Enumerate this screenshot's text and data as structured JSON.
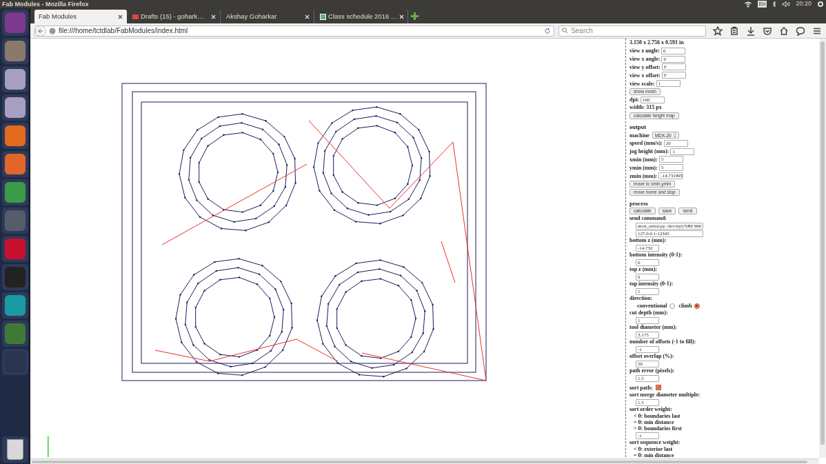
{
  "window": {
    "title": "Fab Modules - Mozilla Firefox"
  },
  "indicators": {
    "keyboard": "En",
    "time": "20:20"
  },
  "tabs": [
    {
      "title": "Fab Modules",
      "selected": true,
      "kind": "plain"
    },
    {
      "title": "Drafts (15) - gohark…",
      "selected": false,
      "kind": "mail"
    },
    {
      "title": "Akshay Goharkar",
      "selected": false,
      "kind": "plain"
    },
    {
      "title": "Class schedule 2016 …",
      "selected": false,
      "kind": "site"
    }
  ],
  "address_bar": {
    "url": "file:///home/tctdlab/FabModules/index.html"
  },
  "search": {
    "placeholder": "Search"
  },
  "panel": [
    {
      "kind": "text",
      "text": "3.150 x 2.756 x 0.591 in"
    },
    {
      "kind": "field",
      "label": "view z angle:",
      "value": "0"
    },
    {
      "kind": "field",
      "label": "view x angle:",
      "value": "0"
    },
    {
      "kind": "field",
      "label": "view y offset:",
      "value": "0"
    },
    {
      "kind": "field",
      "label": "view x offset:",
      "value": "0"
    },
    {
      "kind": "field",
      "label": "view scale:",
      "value": "1"
    },
    {
      "kind": "buttons",
      "buttons": [
        "show mesh"
      ]
    },
    {
      "kind": "field",
      "label": "dpi:",
      "value": "100"
    },
    {
      "kind": "text",
      "text": "width: 315 px"
    },
    {
      "kind": "buttons",
      "buttons": [
        "calculate height map"
      ]
    },
    {
      "kind": "heading",
      "text": "output"
    },
    {
      "kind": "select",
      "label": "machine",
      "value": "MDX-20"
    },
    {
      "kind": "field",
      "label": "speed (mm/s):",
      "value": "20"
    },
    {
      "kind": "field",
      "label": "jog height (mm):",
      "value": "1"
    },
    {
      "kind": "field",
      "label": "xmin (mm):",
      "value": "5"
    },
    {
      "kind": "field",
      "label": "ymin (mm):",
      "value": "5"
    },
    {
      "kind": "field",
      "label": "zmin (mm):",
      "value": "-14.731995"
    },
    {
      "kind": "buttons",
      "buttons": [
        "move to xmin,ymin"
      ]
    },
    {
      "kind": "buttons",
      "buttons": [
        "move home and stop"
      ]
    },
    {
      "kind": "heading",
      "text": "process"
    },
    {
      "kind": "buttons",
      "buttons": [
        "calculate",
        "save",
        "send"
      ]
    },
    {
      "kind": "stacked",
      "label": "send command:",
      "values": [
        "mod_serial.py /dev/ttyUSB0 960",
        "127.0.0.1:12345"
      ]
    },
    {
      "kind": "stacked",
      "label": "bottom z (mm):",
      "values": [
        "-14.732"
      ]
    },
    {
      "kind": "stacked",
      "label": "bottom intensity (0-1):",
      "values": [
        "0"
      ]
    },
    {
      "kind": "stacked",
      "label": "top z (mm):",
      "values": [
        "0"
      ]
    },
    {
      "kind": "stacked",
      "label": "top intensity (0-1):",
      "values": [
        "1"
      ]
    },
    {
      "kind": "radio",
      "label": "direction:",
      "options": [
        {
          "label": "conventional",
          "selected": false
        },
        {
          "label": "climb",
          "selected": true
        }
      ]
    },
    {
      "kind": "stacked",
      "label": "cut depth (mm):",
      "values": [
        "1"
      ]
    },
    {
      "kind": "stacked",
      "label": "tool diameter (mm):",
      "values": [
        "3.175"
      ]
    },
    {
      "kind": "stacked",
      "label": "number of offsets (-1 to fill):",
      "values": [
        "-1"
      ]
    },
    {
      "kind": "stacked",
      "label": "offset overlap (%):",
      "values": [
        "50"
      ]
    },
    {
      "kind": "stacked",
      "label": "path error (pixels):",
      "values": [
        "1.5"
      ]
    },
    {
      "kind": "checkbox",
      "label": "sort path:",
      "checked": true
    },
    {
      "kind": "stacked",
      "label": "sort merge diameter multiple:",
      "values": [
        "1.5"
      ]
    },
    {
      "kind": "notes",
      "label": "sort order weight:",
      "lines": [
        "< 0: boundaries last",
        "= 0: min distance",
        "> 0: boundaries first"
      ],
      "values": [
        "-1"
      ]
    },
    {
      "kind": "notes",
      "label": "sort sequence weight:",
      "lines": [
        "< 0: exterior last",
        "= 0: min distance"
      ]
    }
  ]
}
